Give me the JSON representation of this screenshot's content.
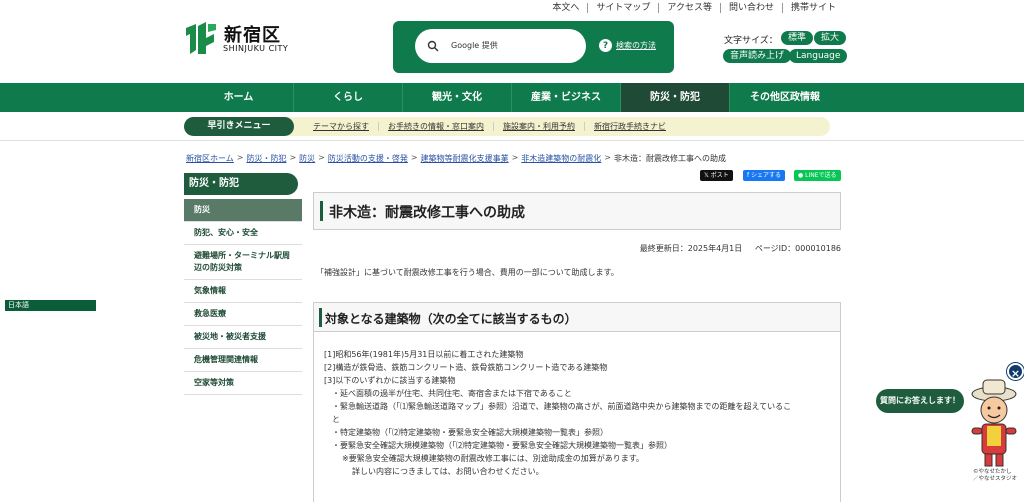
{
  "utility_links": [
    "本文へ",
    "サイトマップ",
    "アクセス等",
    "問い合わせ",
    "携帯サイト"
  ],
  "logo": {
    "name": "新宿区",
    "sub": "SHINJUKU CITY"
  },
  "search": {
    "label": "Google 提供",
    "howto": "検索の方法"
  },
  "font_size": {
    "label": "文字サイズ：",
    "standard": "標準",
    "large": "拡大",
    "read_aloud": "音声読み上げ",
    "language": "Language"
  },
  "nav": {
    "items": [
      "ホーム",
      "くらし",
      "観光・文化",
      "産業・ビジネス",
      "防災・防犯",
      "その他区政情報"
    ],
    "active_index": 4
  },
  "quick_menu": {
    "title": "早引きメニュー",
    "links": [
      "テーマから探す",
      "お手続きの情報・窓口案内",
      "施設案内・利用予約",
      "新宿行政手続きナビ"
    ]
  },
  "breadcrumb": {
    "links": [
      "新宿区ホーム",
      "防災・防犯",
      "防災",
      "防災活動の支援・啓発",
      "建築物等耐震化支援事業",
      "非木造建築物の耐震化"
    ],
    "current": "非木造：耐震改修工事への助成"
  },
  "language_label": "日本語",
  "sidebar": {
    "title": "防災・防犯",
    "items": [
      {
        "label": "防災",
        "active": true
      },
      {
        "label": "防犯、安心・安全"
      },
      {
        "label": "避難場所・ターミナル駅周辺の防災対策"
      },
      {
        "label": "気象情報"
      },
      {
        "label": "救急医療"
      },
      {
        "label": "被災地・被災者支援"
      },
      {
        "label": "危機管理関連情報"
      },
      {
        "label": "空家等対策"
      }
    ]
  },
  "share": {
    "x": "ポスト",
    "facebook": "シェアする",
    "line": "LINEで送る"
  },
  "page": {
    "title": "非木造：耐震改修工事への助成",
    "updated": "最終更新日：2025年4月1日",
    "page_id": "ページID：000010186",
    "intro": "「補強設計」に基づいて耐震改修工事を行う場合、費用の一部について助成します。",
    "section_title": "対象となる建築物（次の全てに該当するもの）",
    "lines": [
      "[1]昭和56年(1981年)5月31日以前に着工された建築物",
      "[2]構造が鉄骨造、鉄筋コンクリート造、鉄骨鉄筋コンクリート造である建築物",
      "[3]以下のいずれかに該当する建築物",
      "・延べ面積の過半が住宅、共同住宅、寄宿舎または下宿であること",
      "・緊急輸送道路（「⑴緊急輸送道路マップ」参照）沿道で、建築物の高さが、前面道路中央から建築物までの距離を超えているこ",
      "と",
      "・特定建築物（「⑵特定建築物・要緊急安全確認大規模建築物一覧表」参照）",
      "・要緊急安全確認大規模建築物（「⑵特定建築物・要緊急安全確認大規模建築物一覧表」参照）",
      "※要緊急安全確認大規模建築物の耐震改修工事には、別途助成金の加算があります。",
      "詳しい内容につきましては、お問い合わせください。"
    ]
  },
  "mascot": {
    "bubble": "質問にお答えします！",
    "close": "×",
    "credit_1": "©やなせたかし",
    "credit_2": "／やなせスタジオ"
  },
  "colors": {
    "brand_green": "#0f7a4b",
    "dark_green": "#1f5c3d",
    "link_blue": "#2851a3",
    "quick_bg": "#f4f2cf"
  }
}
